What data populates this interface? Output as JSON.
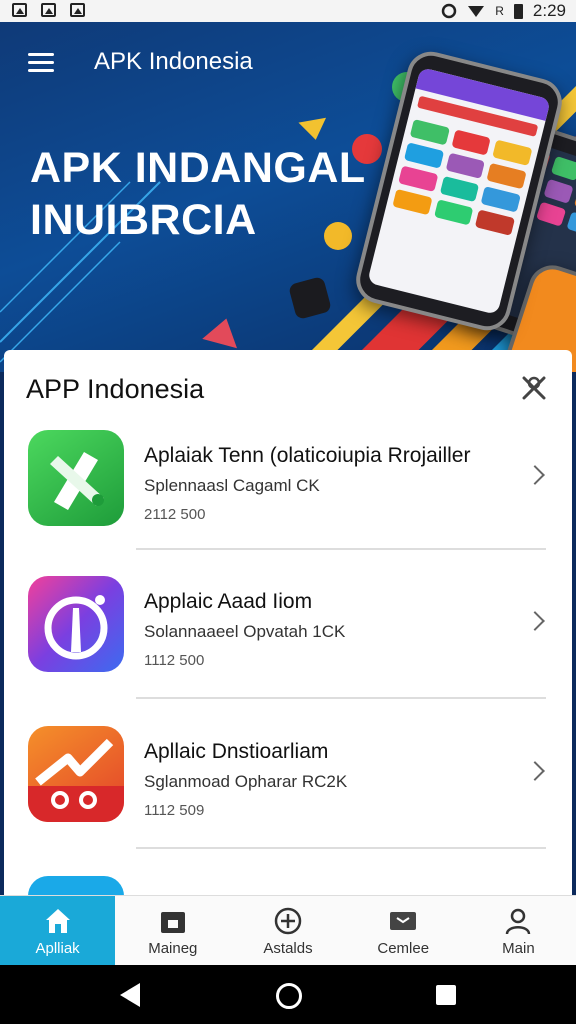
{
  "status_bar": {
    "time": "2:29",
    "signal_text": "R",
    "left_icons": [
      "image-icon",
      "image-icon",
      "image-icon"
    ]
  },
  "hero": {
    "title": "APK Indonesia",
    "headline_line1": "APK INDANGAL",
    "headline_line2": "INUIBRCIA"
  },
  "card": {
    "title": "APP Indonesia",
    "items": [
      {
        "name": "Aplaiak Tenn (olaticoiupia Rrojailler",
        "subtitle": "Splennaasl Cagaml CK",
        "meta": "2112 500"
      },
      {
        "name": "Applaic Aaad Iiom",
        "subtitle": "Solannaaeel Opvatah 1CK",
        "meta": "1112 500"
      },
      {
        "name": "Apllaic Dnstioarliam",
        "subtitle": "Sglanmoad Opharar RC2K",
        "meta": "1112 509"
      },
      {
        "name": "",
        "subtitle": "",
        "meta": ""
      }
    ]
  },
  "bottom_nav": [
    {
      "label": "Aplliak",
      "icon": "home-icon"
    },
    {
      "label": "Maineg",
      "icon": "store-icon"
    },
    {
      "label": "Astalds",
      "icon": "download-icon"
    },
    {
      "label": "Cemlee",
      "icon": "grid-icon"
    },
    {
      "label": "Main",
      "icon": "person-icon"
    }
  ],
  "colors": {
    "accent": "#1aa9d8",
    "hero_bg": "#0d4d97"
  }
}
